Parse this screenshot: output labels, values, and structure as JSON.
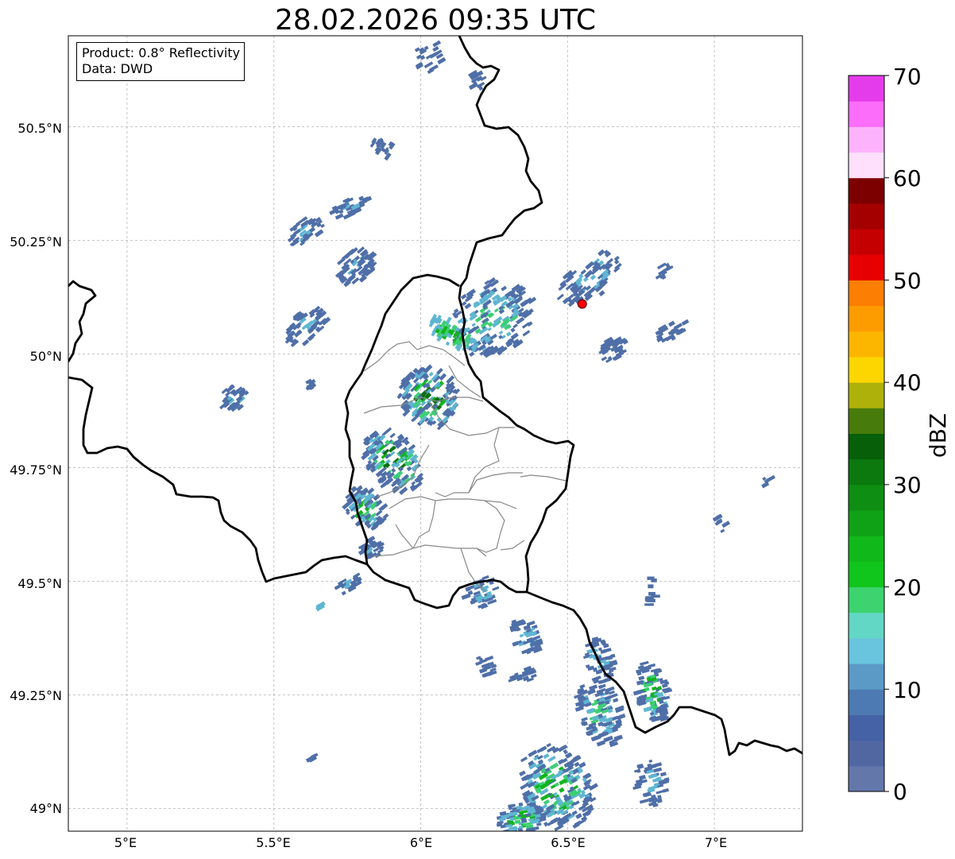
{
  "title": "28.02.2026 09:35 UTC",
  "info": {
    "product": "Product: 0.8° Reflectivity",
    "data": "Data: DWD"
  },
  "axes": {
    "lon_ticks": [
      "5°E",
      "5.5°E",
      "6°E",
      "6.5°E",
      "7°E"
    ],
    "lat_ticks": [
      "50.5°N",
      "50.25°N",
      "50°N",
      "49.75°N",
      "49.5°N",
      "49.25°N",
      "49°N"
    ],
    "lon_range": [
      4.8,
      7.3
    ],
    "lat_range": [
      48.95,
      50.7
    ]
  },
  "colorbar": {
    "label": "dBZ",
    "ticks": [
      "0",
      "10",
      "20",
      "30",
      "40",
      "50",
      "60",
      "70"
    ],
    "range": [
      0,
      70
    ],
    "step": 2.5,
    "colors": [
      "#6377ab",
      "#5067a1",
      "#4462a5",
      "#4d7ab2",
      "#5b9ac6",
      "#69c4dd",
      "#63d7c5",
      "#3dd36f",
      "#10c51c",
      "#11b81a",
      "#10a216",
      "#0e8e12",
      "#0b790e",
      "#075f09",
      "#477b0b",
      "#aeb10a",
      "#fdd600",
      "#fdb600",
      "#fd9c00",
      "#fc7e02",
      "#e60000",
      "#c50000",
      "#a50000",
      "#7c0000",
      "#fee0fd",
      "#fdb3fc",
      "#fc6df9",
      "#e53ceb"
    ]
  },
  "radar_site": {
    "lon": 6.55,
    "lat": 50.11,
    "color": "#ff0000"
  },
  "map_colors": {
    "border": "#000000",
    "admin": "#888888",
    "grid": "#b4b4b4"
  },
  "echo_colors": {
    "weak": "#4f6fa8",
    "light": "#5fb6d2",
    "moderate": "#3ccf74",
    "strong": "#10b51b",
    "core": "#0b6e0e"
  }
}
